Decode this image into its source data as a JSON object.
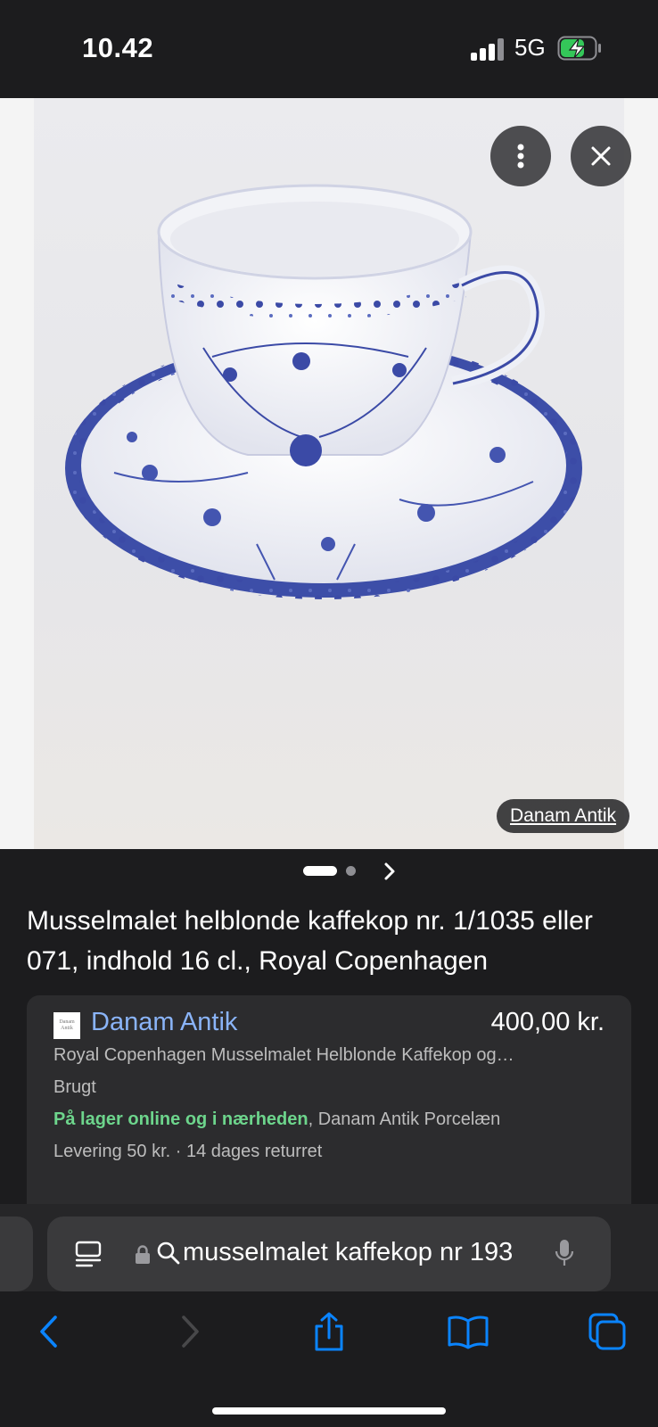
{
  "status_bar": {
    "time": "10.42",
    "network": "5G"
  },
  "image_viewer": {
    "more_icon": "more-vertical-icon",
    "close_icon": "close-icon",
    "source_label": "Danam Antik",
    "carousel": {
      "total_pages": 2,
      "current_page": 1
    }
  },
  "product": {
    "title": "Musselmalet helblonde kaffekop nr. 1/1035 eller 071, indhold 16 cl., Royal Copenhagen",
    "merchant": "Danam Antik",
    "merchant_logo_text": "Danam Antik",
    "price": "400,00 kr.",
    "description": "Royal Copenhagen Musselmalet Helblonde Kaffekop og…",
    "condition": "Brugt",
    "stock_status": "På lager online og i nærheden",
    "stock_location": ", Danam Antik Porcelæn",
    "delivery": "Levering 50 kr. · 14 dages returret"
  },
  "browser": {
    "url_text": "musselmalet kaffekop nr 193",
    "accent_color": "#0a84ff",
    "toolbar_icons": [
      "back-icon",
      "forward-icon",
      "share-icon",
      "bookmarks-icon",
      "tabs-icon"
    ]
  }
}
